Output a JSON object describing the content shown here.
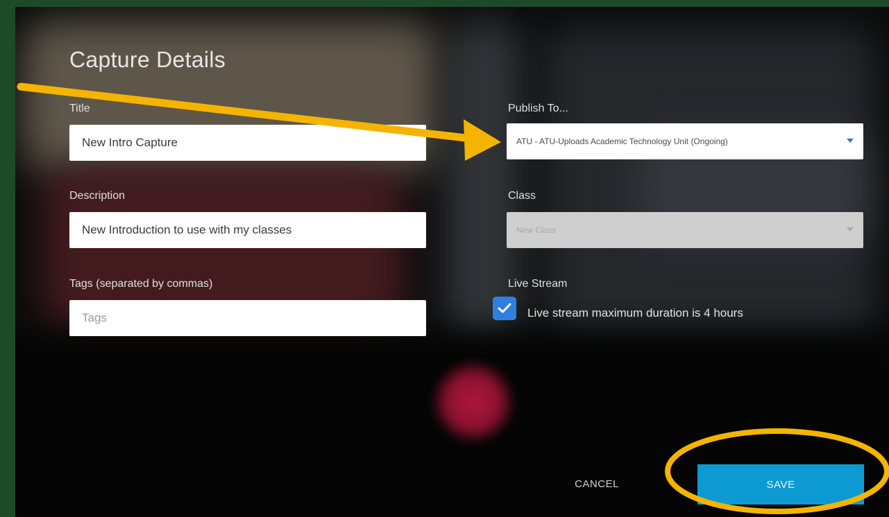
{
  "dialog": {
    "title": "Capture Details"
  },
  "form": {
    "title_label": "Title",
    "title_value": "New Intro Capture",
    "description_label": "Description",
    "description_value": "New Introduction to use with my classes",
    "tags_label": "Tags (separated by commas)",
    "tags_placeholder": "Tags",
    "publish_label": "Publish To...",
    "publish_value": "ATU - ATU-Uploads Academic Technology Unit (Ongoing)",
    "class_label": "Class",
    "class_value": "New Class",
    "live_stream_label": "Live Stream",
    "live_stream_checked": true,
    "live_stream_text": "Live stream maximum duration is 4 hours"
  },
  "actions": {
    "cancel_label": "CANCEL",
    "save_label": "SAVE"
  },
  "colors": {
    "frame_border": "#1f4a2a",
    "save_button": "#0d9ad3",
    "checkbox": "#2f7fe0",
    "annotation": "#f5b400"
  },
  "icons": {
    "checkbox": "checkmark-icon",
    "dropdown": "chevron-down-icon",
    "annotation_arrow": "arrow-icon",
    "annotation_circle": "highlight-circle"
  }
}
